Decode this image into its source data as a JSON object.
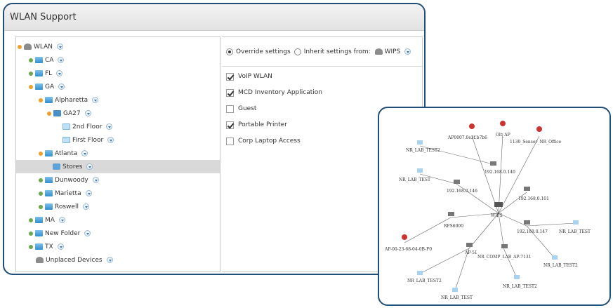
{
  "window": {
    "title": "WLAN Support"
  },
  "tree": [
    {
      "label": "WLAN",
      "toggle": "open",
      "icon": "wlan-icon"
    },
    {
      "label": "CA",
      "toggle": "closed",
      "icon": "folder-icon"
    },
    {
      "label": "FL",
      "toggle": "closed",
      "icon": "folder-icon"
    },
    {
      "label": "GA",
      "toggle": "open",
      "icon": "folder-icon"
    },
    {
      "label": "Alpharetta",
      "toggle": "open",
      "icon": "folder-icon"
    },
    {
      "label": "GA27",
      "toggle": "open",
      "icon": "site-icon"
    },
    {
      "label": "2nd Floor",
      "toggle": "none",
      "icon": "floor-icon"
    },
    {
      "label": "First Floor",
      "toggle": "none",
      "icon": "floor-icon"
    },
    {
      "label": "Atlanta",
      "toggle": "open",
      "icon": "folder-icon"
    },
    {
      "label": "Stores",
      "toggle": "none",
      "icon": "store-icon",
      "selected": true
    },
    {
      "label": "Dunwoody",
      "toggle": "closed",
      "icon": "folder-icon"
    },
    {
      "label": "Marietta",
      "toggle": "closed",
      "icon": "folder-icon"
    },
    {
      "label": "Roswell",
      "toggle": "closed",
      "icon": "folder-icon"
    },
    {
      "label": "MA",
      "toggle": "closed",
      "icon": "folder-icon"
    },
    {
      "label": "New Folder",
      "toggle": "closed",
      "icon": "folder-icon"
    },
    {
      "label": "TX",
      "toggle": "closed",
      "icon": "folder-icon"
    },
    {
      "label": "Unplaced Devices",
      "toggle": "none",
      "icon": "wlan-icon"
    }
  ],
  "settings": {
    "override_label": "Override settings",
    "inherit_label": "Inherit settings from:",
    "inherit_source": "WIPS",
    "options": [
      {
        "label": "VoIP WLAN",
        "checked": true
      },
      {
        "label": "MCD Inventory Application",
        "checked": true
      },
      {
        "label": "Guest",
        "checked": false
      },
      {
        "label": "Portable Printer",
        "checked": true
      },
      {
        "label": "Corp Laptop Access",
        "checked": false
      }
    ]
  },
  "graph": {
    "nodes": {
      "ap1": "AP0007.0e3f.b7b6",
      "ap2": "Olt_AP",
      "ap3": "1130_Sensor_NR_Office",
      "lab1": "NR_LAB_TEST2",
      "ip140": "192.168.0.140",
      "lab2": "NR_LAB_TEST",
      "ip146": "192.168.0.146",
      "ip101": "192.168.0.101",
      "wips": "WIPS",
      "rfs": "RFS6000",
      "ip147": "192.168.0.147",
      "lab3": "NR_LAB_TEST",
      "ap4": "AP-00-23-68-04-0B-F0",
      "ap5": "AP-51",
      "comp": "NR_COMP_LAB_AP-7131",
      "lab4": "NR_LAB_TEST2",
      "lab5": "NR_LAB_TEST2",
      "lab6": "NR_LAB_TEST2",
      "lab7": "NR_LAB_TEST"
    }
  }
}
